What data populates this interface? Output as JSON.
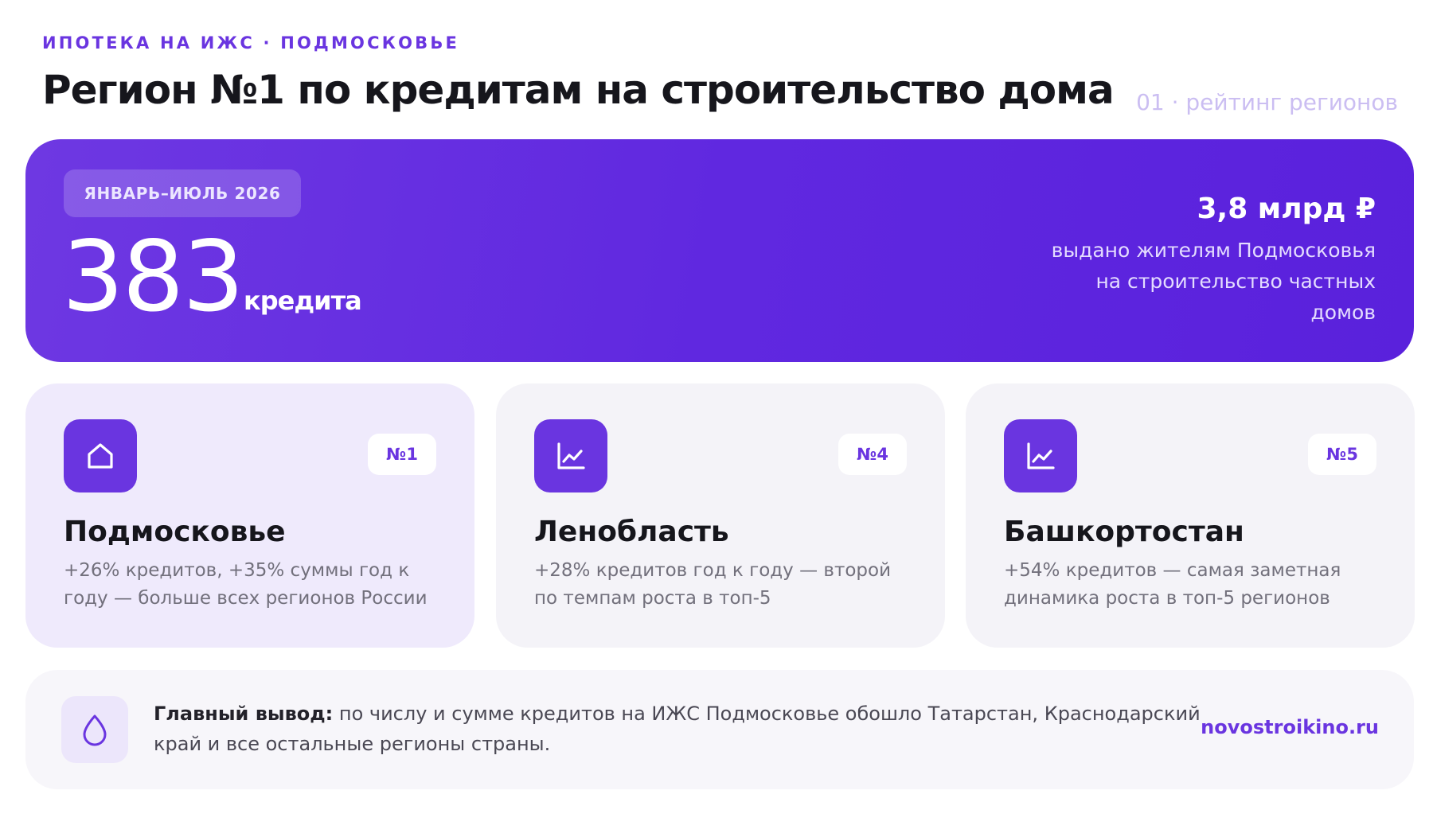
{
  "header": {
    "kicker": "ИПОТЕКА НА ИЖС · ПОДМОСКОВЬЕ",
    "title": "Регион №1 по кредитам на строительство дома",
    "section_tag": "01 · рейтинг регионов"
  },
  "hero": {
    "period": "ЯНВАРЬ–ИЮЛЬ 2026",
    "count": "383",
    "count_unit": "кредита",
    "amount": "3,8 млрд ₽",
    "description": "выдано жителям Подмосковья на строительство частных домов"
  },
  "regions": [
    {
      "icon": "house-icon",
      "rank": "№1",
      "name": "Подмосковье",
      "text": "+26% кредитов, +35% суммы год к году — больше всех регионов России"
    },
    {
      "icon": "chart-line-icon",
      "rank": "№4",
      "name": "Ленобласть",
      "text": "+28% кредитов год к году — второй по темпам роста в топ-5"
    },
    {
      "icon": "chart-line-icon",
      "rank": "№5",
      "name": "Башкортостан",
      "text": "+54% кредитов — самая заметная динамика роста в топ-5 регионов"
    }
  ],
  "summary": {
    "icon": "drop-icon",
    "label": "Главный вывод:",
    "text": " по числу и сумме кредитов на ИЖС Подмосковье обошло Татарстан, Краснодарский край и все остальные регионы страны.",
    "link": "novostroikino.ru"
  },
  "colors": {
    "accent": "#6a35e0",
    "hero_start": "#6e38e2",
    "hero_end": "#5a21dc",
    "card_highlight": "#efeafc",
    "card": "#f4f3f8"
  }
}
